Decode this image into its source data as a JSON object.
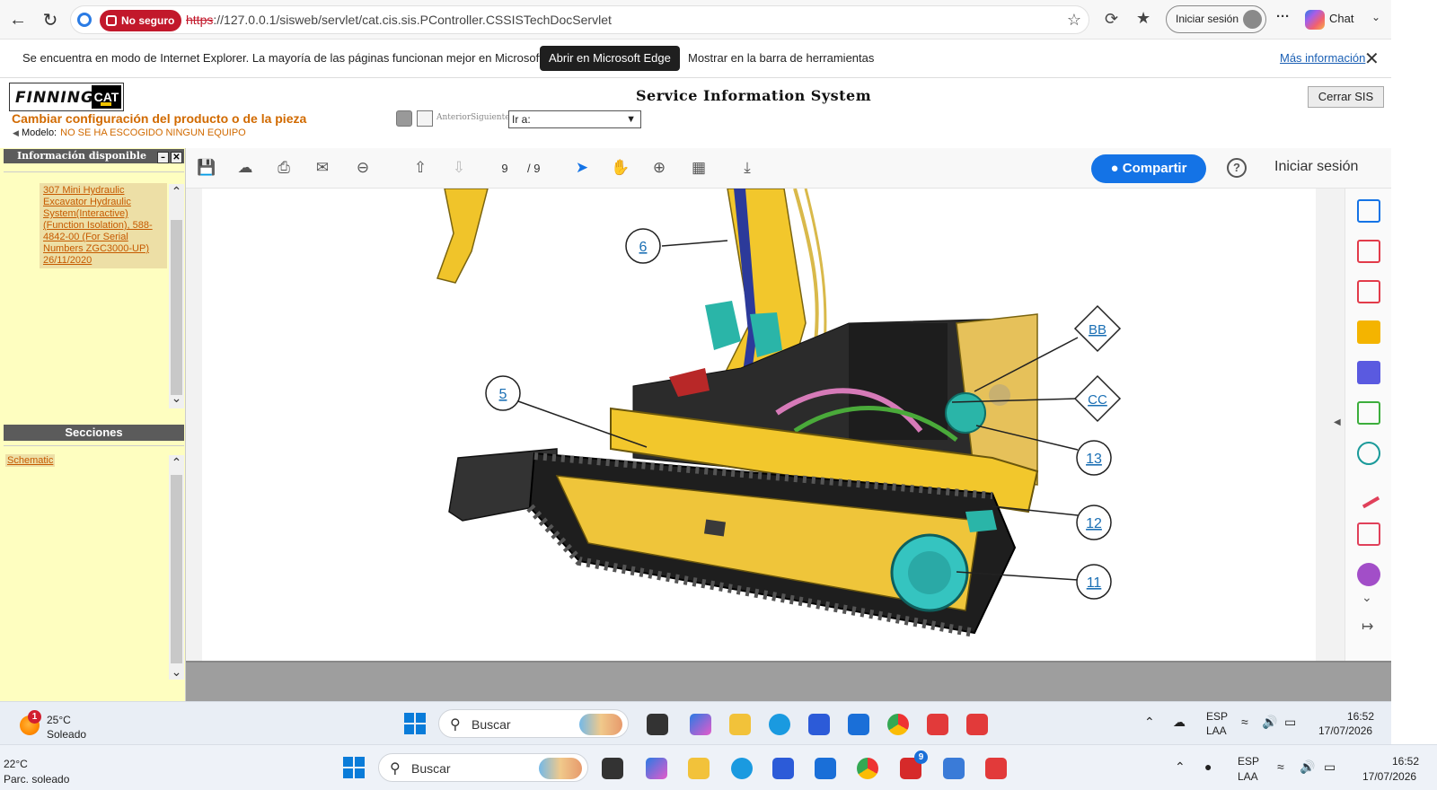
{
  "browser": {
    "security_label": "No seguro",
    "url_scheme": "https",
    "url_rest": "://127.0.0.1/sisweb/servlet/cat.cis.sis.PController.CSSISTechDocServlet",
    "signin_label": "Iniciar sesión",
    "more_label": "···",
    "chat_label": "Chat"
  },
  "ie_bar": {
    "message": "Se encuentra en modo de Internet Explorer. La mayoría de las páginas funcionan mejor en Microsoft Edge.",
    "open_edge_label": "Abrir en Microsoft Edge",
    "show_toolbar_label": "Mostrar en la barra de herramientas",
    "more_info_label": "Más información"
  },
  "sis": {
    "logo_text": "FINNING",
    "logo_cat": "CAT",
    "title": "Service Information System",
    "close_label": "Cerrar SIS",
    "change_config": "Cambiar configuración del producto o de la pieza",
    "model_label": "Modelo:",
    "model_value": "NO SE HA ESCOGIDO NINGUN EQUIPO",
    "prev_label": "Anterior",
    "next_label": "Siguiente",
    "goto_label": "Ir a:"
  },
  "left_panel": {
    "info_header": "Información disponible",
    "document_link": "307 Mini Hydraulic Excavator Hydraulic System(Interactive) (Function Isolation), 588-4842-00 (For Serial Numbers ZGC3000-UP) 26/11/2020",
    "sections_header": "Secciones",
    "section_link": "Schematic"
  },
  "pdf_toolbar": {
    "page_current": "9",
    "page_total": "/ 9",
    "share_label": "Compartir",
    "help_label": "?",
    "signin_label": "Iniciar sesión"
  },
  "callouts": [
    "6",
    "5",
    "BB",
    "CC",
    "13",
    "12",
    "11"
  ],
  "taskbar_inner": {
    "weather_temp": "25°C",
    "weather_desc": "Soleado",
    "weather_badge": "1",
    "search_label": "Buscar",
    "lang": "ESP",
    "layout": "LAA",
    "time": "16:52",
    "date": "17/07/2026"
  },
  "taskbar_outer": {
    "weather_temp": "22°C",
    "weather_desc": "Parc. soleado",
    "search_label": "Buscar",
    "lang": "ESP",
    "layout": "LAA",
    "time": "16:52",
    "date": "17/07/2026",
    "app_badge": "9"
  },
  "colors": {
    "accent_blue": "#1473e6",
    "sis_orange": "#d16a00",
    "not_secure_red": "#c2182b",
    "panel_yellow": "#fefec0",
    "machine_yellow": "#f2c72c"
  }
}
